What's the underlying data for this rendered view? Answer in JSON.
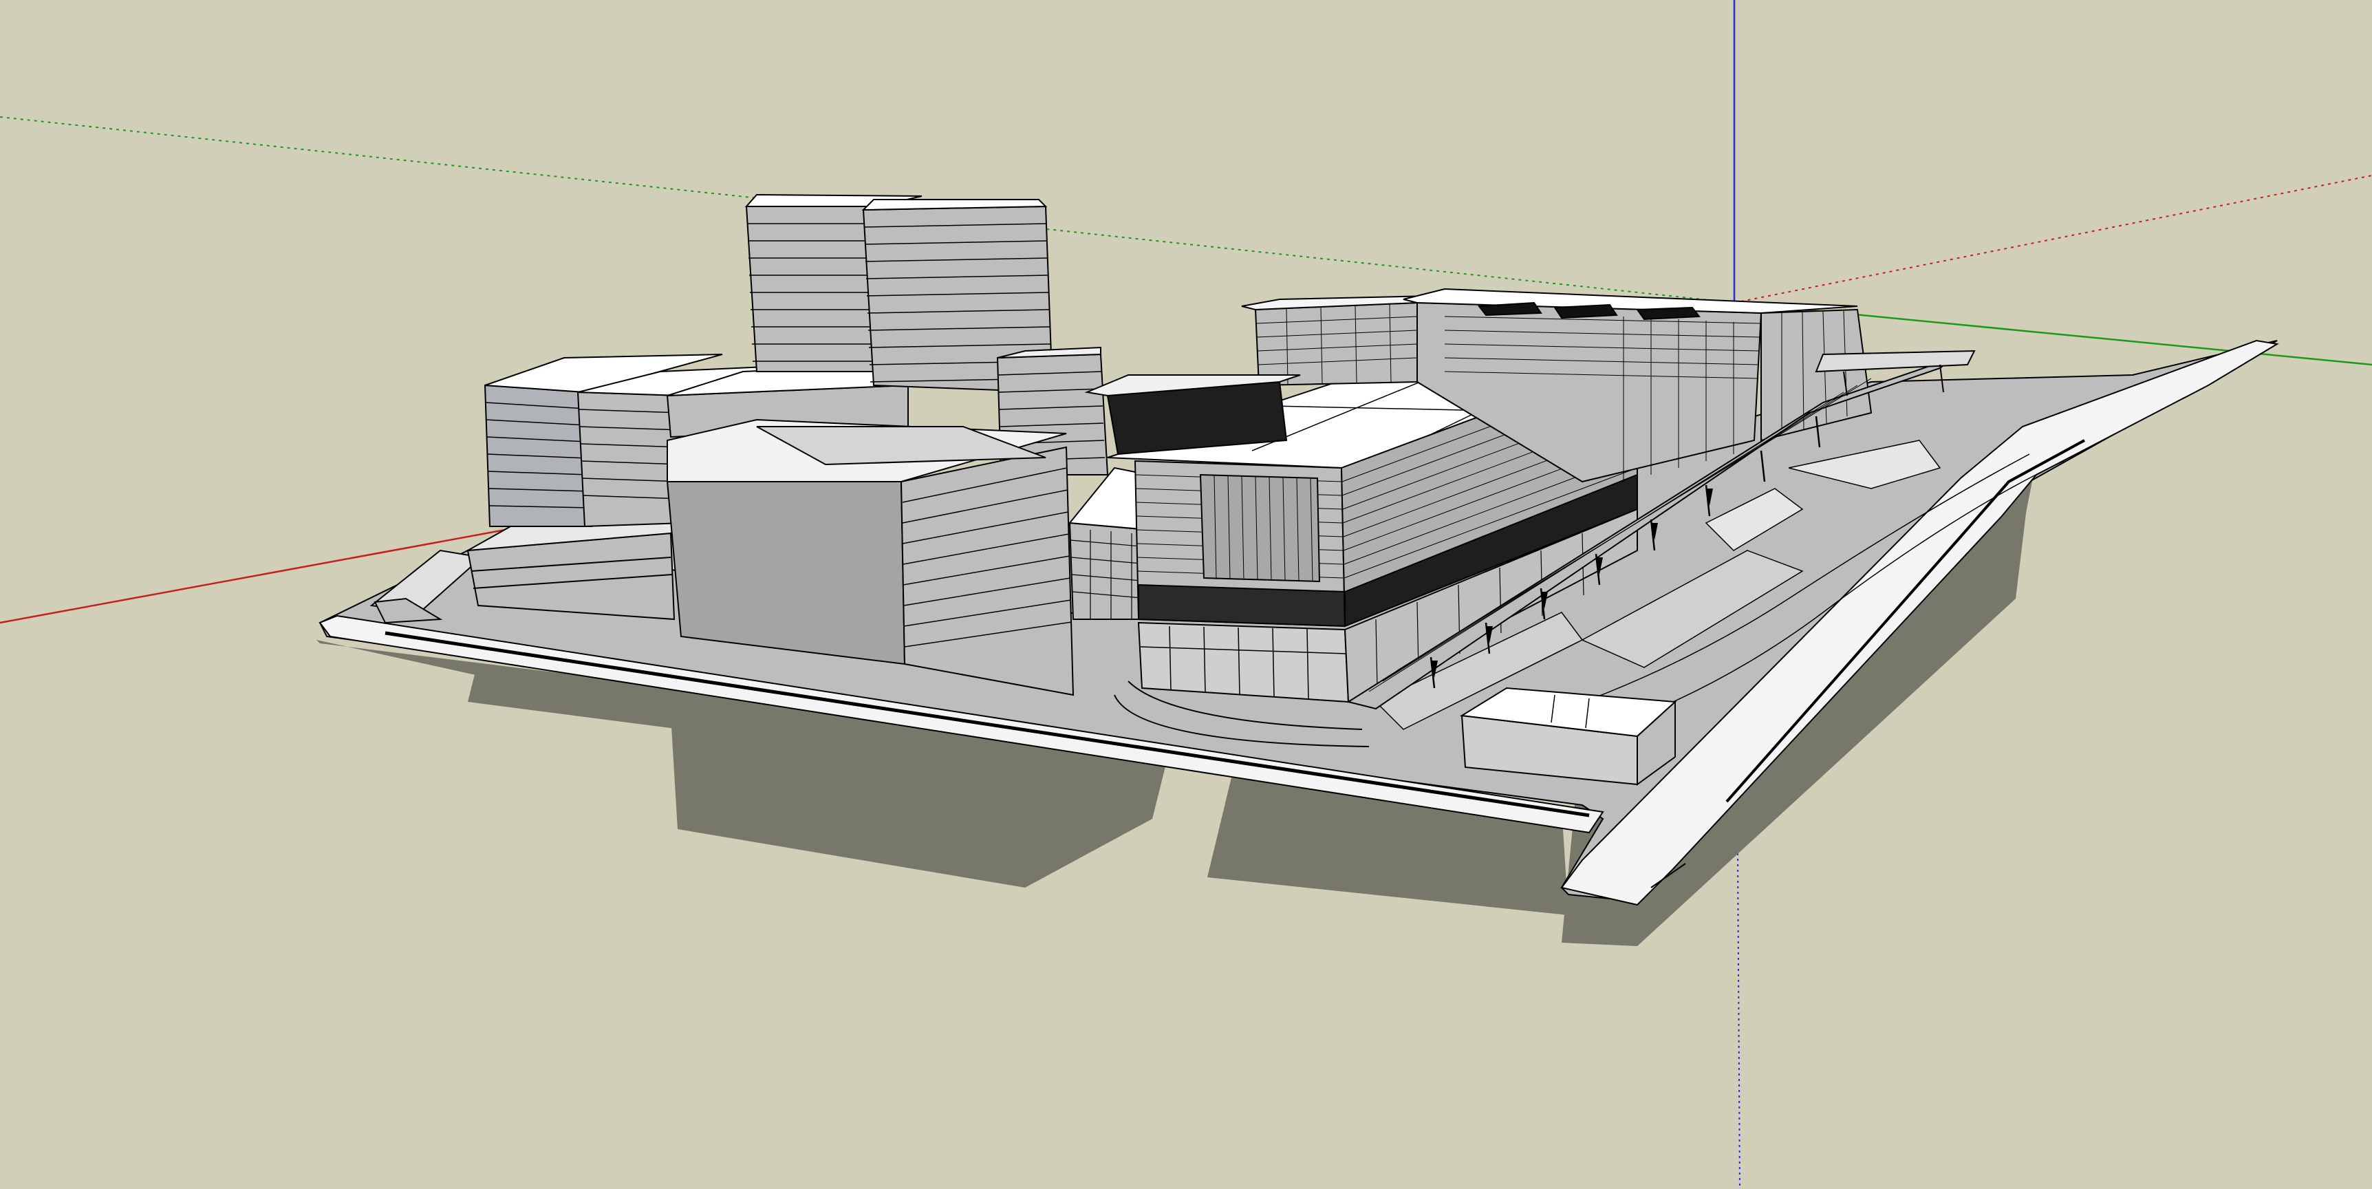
{
  "app": {
    "kind": "3d-modeling-viewport",
    "view": "perspective"
  },
  "viewport": {
    "background_color": "#d1cfb8",
    "shadow_color": "#77776a",
    "axes": {
      "red_axis_color": "#c81e1e",
      "green_axis_color": "#1a9a1a",
      "blue_axis_color": "#2b2bd0"
    },
    "model": {
      "description_icon": "building-complex-model",
      "face_color": "#bdbdbd",
      "top_color": "#ffffff",
      "edge_color": "#000000"
    }
  }
}
